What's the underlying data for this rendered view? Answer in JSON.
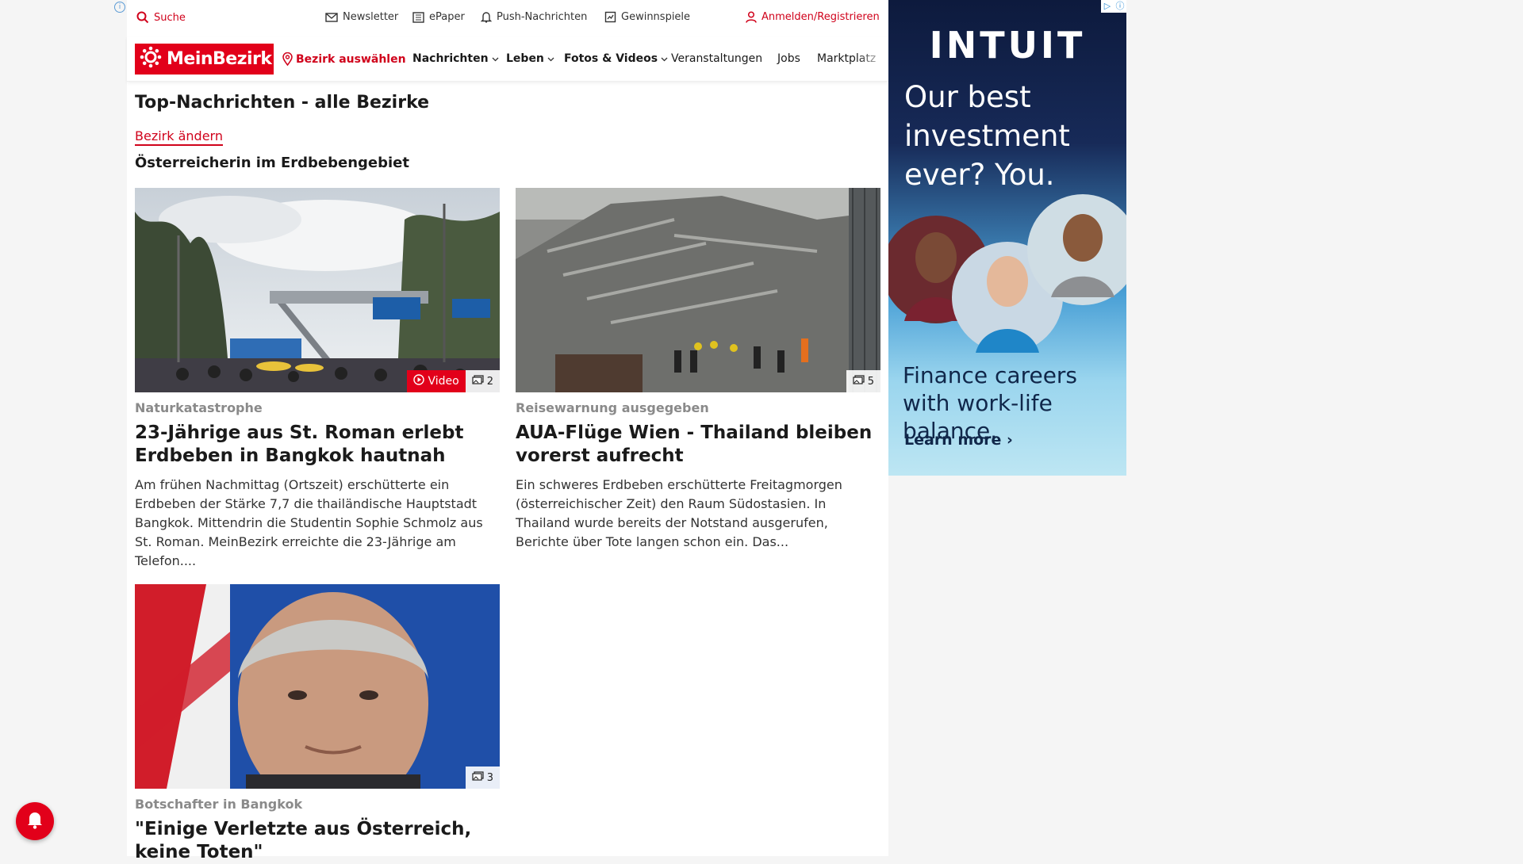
{
  "util": {
    "search_label": "Suche",
    "newsletter_label": "Newsletter",
    "epaper_label": "ePaper",
    "push_label": "Push-Nachrichten",
    "gewinnspiele_label": "Gewinnspiele",
    "login_label": "Anmelden/Registrieren"
  },
  "nav": {
    "logo_text": "MeinBezirk",
    "bezirk_label": "Bezirk auswählen",
    "items": [
      "Nachrichten",
      "Leben",
      "Fotos & Videos",
      "Veranstaltungen",
      "Jobs",
      "Marktplatz"
    ]
  },
  "main": {
    "section_title": "Top-Nachrichten - alle Bezirke",
    "change_link": "Bezirk ändern",
    "sub_title": "Österreicherin im Erdbebengebiet",
    "articles": [
      {
        "kicker": "Naturkatastrophe",
        "headline": "23-Jährige aus St. Roman erlebt Erdbeben in Bangkok hautnah",
        "teaser": "Am frühen Nachmittag (Ortszeit) erschütterte ein Erdbeben der Stärke 7,7 die thailändische Hauptstadt Bangkok. Mittendrin die Studentin Sophie Schmolz aus St. Roman. MeinBezirk erreichte die 23-Jährige am Telefon....",
        "video_label": "Video",
        "photo_count": "2"
      },
      {
        "kicker": "Reisewarnung ausgegeben",
        "headline": "AUA-Flüge Wien - Thailand bleiben vorerst aufrecht",
        "teaser": "Ein schweres Erdbeben erschütterte Freitagmorgen (österreichischer Zeit) den Raum Südostasien. In Thailand wurde bereits der Notstand ausgerufen, Berichte über Tote langen schon ein. Das...",
        "photo_count": "5"
      },
      {
        "kicker": "Botschafter in Bangkok",
        "headline": "\"Einige Verletzte aus Österreich, keine Toten\"",
        "photo_count": "3"
      }
    ]
  },
  "ad": {
    "brand": "INTUIT",
    "headline": "Our best investment ever? You.",
    "subline": "Finance careers with work-life balance.",
    "cta": "Learn more ›"
  },
  "colors": {
    "brand_red": "#e2001a",
    "link_red": "#d0021b"
  }
}
